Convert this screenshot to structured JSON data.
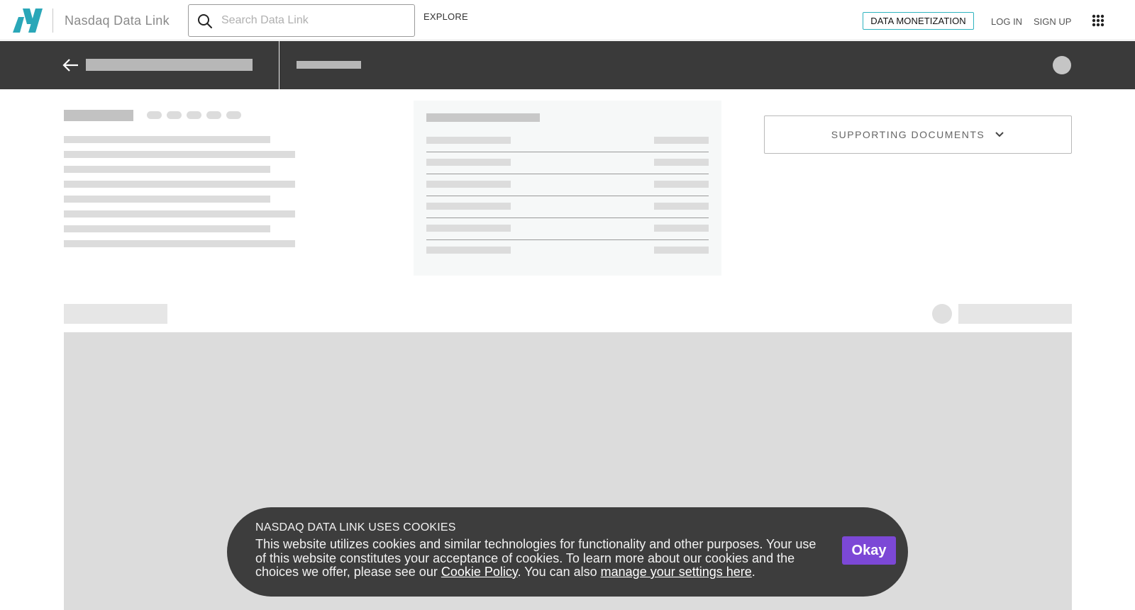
{
  "nav": {
    "brand": "Nasdaq Data Link",
    "search_placeholder": "Search Data Link",
    "explore": "EXPLORE",
    "data_monetization": "DATA MONETIZATION",
    "login": "LOG IN",
    "signup": "SIGN UP"
  },
  "colors": {
    "logo": "#2aa7b8",
    "monetization_border": "#2fb3bf",
    "header_band": "#3a3a3a",
    "okay_button": "#7c48d6"
  },
  "icons": {
    "logo": "nasdaq-logo-icon",
    "search": "search-icon",
    "apps": "apps-grid-icon",
    "back": "back-arrow-icon",
    "chevron": "chevron-down-icon"
  },
  "supporting_documents": {
    "label": "SUPPORTING DOCUMENTS"
  },
  "cookie": {
    "title": "NASDAQ DATA LINK USES COOKIES",
    "body_start": "This website utilizes cookies and similar technologies for functionality and other purposes. Your use of this website constitutes your acceptance of cookies. To learn more about our cookies and the choices we offer, please see our ",
    "cookie_policy_link": "Cookie Policy",
    "body_middle": ". You can also ",
    "settings_link": "manage your settings here",
    "body_end": ".",
    "okay": "Okay"
  }
}
